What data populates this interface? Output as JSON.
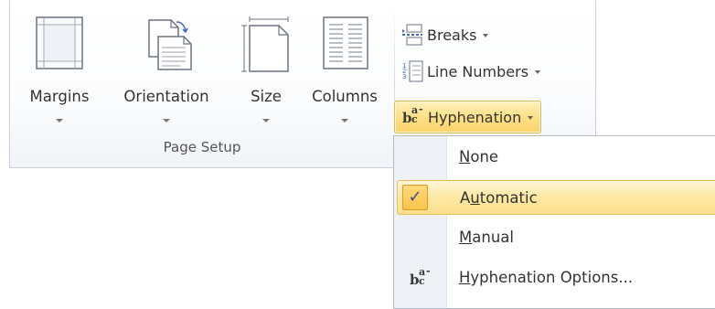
{
  "ribbon": {
    "group_caption": "Page Setup",
    "buttons": [
      {
        "label": "Margins"
      },
      {
        "label": "Orientation"
      },
      {
        "label": "Size"
      },
      {
        "label": "Columns"
      }
    ],
    "small_buttons": [
      {
        "label": "Breaks"
      },
      {
        "label": "Line Numbers"
      },
      {
        "label": "Hyphenation"
      }
    ]
  },
  "hyphenation_menu": {
    "items": [
      {
        "label": "None",
        "checked": false
      },
      {
        "label": "Automatic",
        "checked": true
      },
      {
        "label": "Manual",
        "checked": false
      },
      {
        "label": "Hyphenation Options...",
        "checked": false
      }
    ],
    "check_glyph": "✓"
  },
  "icons": {
    "margins": "margins-icon",
    "orientation": "orientation-icon",
    "size": "size-icon",
    "columns": "columns-icon",
    "breaks": "breaks-icon",
    "line_numbers": "line-numbers-icon",
    "hyphenation": "hyphenation-icon"
  },
  "colors": {
    "highlight": "#fde28a",
    "highlight_border": "#e3b64f",
    "ribbon_border": "#c9d0da"
  }
}
